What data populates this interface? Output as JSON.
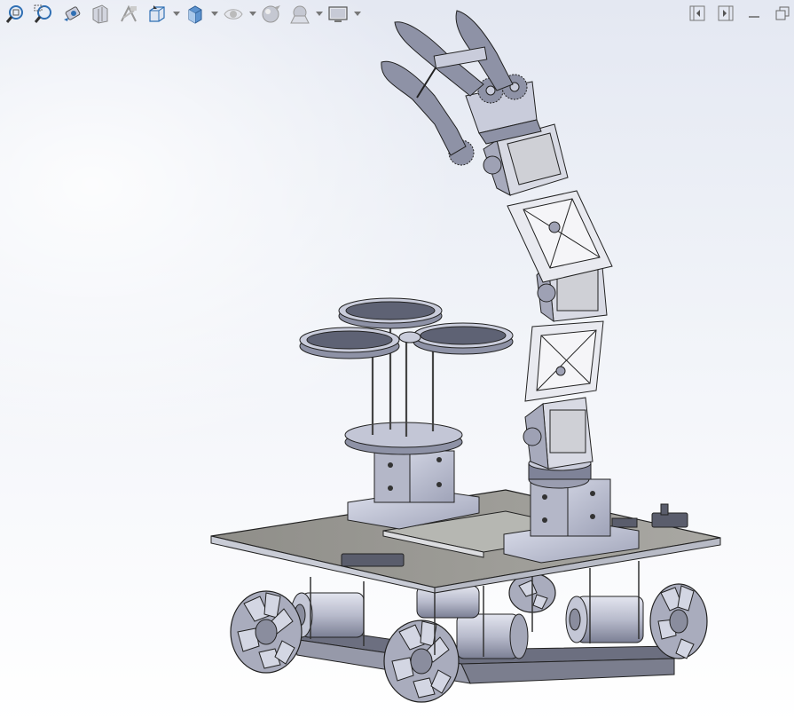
{
  "toolbar": {
    "items": [
      {
        "icon": "zoom-to-fit-icon",
        "dropdown": false
      },
      {
        "icon": "zoom-to-area-icon",
        "dropdown": false
      },
      {
        "icon": "previous-view-icon",
        "dropdown": false
      },
      {
        "icon": "section-view-icon",
        "dropdown": false
      },
      {
        "icon": "dynamic-annotation-icon",
        "dropdown": false
      },
      {
        "icon": "view-orientation-icon",
        "dropdown": true
      },
      {
        "icon": "display-style-icon",
        "dropdown": true
      },
      {
        "icon": "hide-show-items-icon",
        "dropdown": true
      },
      {
        "icon": "edit-appearance-icon",
        "dropdown": false
      },
      {
        "icon": "apply-scene-icon",
        "dropdown": true
      },
      {
        "icon": "view-settings-icon",
        "dropdown": true
      }
    ]
  },
  "window_controls": {
    "items": [
      "collapse-left-icon",
      "collapse-right-icon",
      "minimize-icon",
      "restore-icon"
    ]
  },
  "colors": {
    "part_fill": "#c9ccdb",
    "part_dark": "#7d8197",
    "edge": "#2a2d38",
    "plate_top": "#9e9d98",
    "icon_blue": "#2f6fb3"
  }
}
